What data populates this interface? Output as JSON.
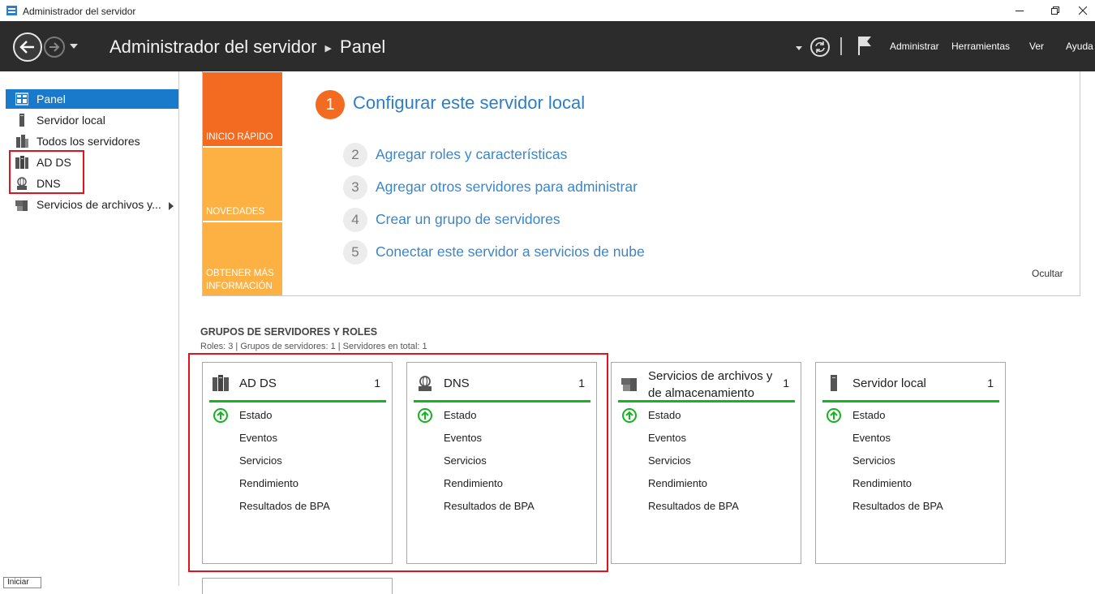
{
  "window": {
    "title": "Administrador del servidor",
    "controls": [
      "minimize",
      "restore",
      "close"
    ]
  },
  "header": {
    "breadcrumb_app": "Administrador del servidor",
    "breadcrumb_page": "Panel",
    "menu": {
      "administrar": "Administrar",
      "herramientas": "Herramientas",
      "ver": "Ver",
      "ayuda": "Ayuda"
    },
    "icons": [
      "back-icon",
      "forward-icon",
      "refresh-icon",
      "flag-icon"
    ]
  },
  "sidebar": {
    "items": [
      {
        "label": "Panel",
        "icon": "dashboard-icon",
        "active": true
      },
      {
        "label": "Servidor local",
        "icon": "server-icon"
      },
      {
        "label": "Todos los servidores",
        "icon": "servers-icon"
      },
      {
        "label": "AD DS",
        "icon": "adds-icon"
      },
      {
        "label": "DNS",
        "icon": "dns-icon"
      },
      {
        "label": "Servicios de archivos y...",
        "icon": "file-services-icon",
        "has_submenu": true
      }
    ]
  },
  "quick_start": {
    "tiles": {
      "inicio": "INICIO RÁPIDO",
      "novedades": "NOVEDADES",
      "obtener": "OBTENER MÁS INFORMACIÓN"
    },
    "step1": {
      "num": "1",
      "text": "Configurar este servidor local"
    },
    "steps": [
      {
        "num": "2",
        "text": "Agregar roles y características"
      },
      {
        "num": "3",
        "text": "Agregar otros servidores para administrar"
      },
      {
        "num": "4",
        "text": "Crear un grupo de servidores"
      },
      {
        "num": "5",
        "text": "Conectar este servidor a servicios de nube"
      }
    ],
    "hide": "Ocultar"
  },
  "groups": {
    "title": "GRUPOS DE SERVIDORES Y ROLES",
    "subtitle": "Roles: 3   |   Grupos de servidores: 1   |   Servidores en total: 1",
    "cards": [
      {
        "title": "AD DS",
        "count": "1",
        "icon": "adds-icon",
        "rows": [
          "Estado",
          "Eventos",
          "Servicios",
          "Rendimiento",
          "Resultados de BPA"
        ]
      },
      {
        "title": "DNS",
        "count": "1",
        "icon": "dns-icon",
        "rows": [
          "Estado",
          "Eventos",
          "Servicios",
          "Rendimiento",
          "Resultados de BPA"
        ]
      },
      {
        "title_line1": "Servicios de archivos y",
        "title_line2": "de almacenamiento",
        "count": "1",
        "icon": "file-services-icon",
        "rows": [
          "Estado",
          "Eventos",
          "Servicios",
          "Rendimiento",
          "Resultados de BPA"
        ]
      },
      {
        "title": "Servidor local",
        "count": "1",
        "icon": "server-icon",
        "rows": [
          "Estado",
          "Eventos",
          "Servicios",
          "Rendimiento",
          "Resultados de BPA"
        ]
      }
    ],
    "status_color": "#13b520"
  },
  "tooltip": "Iniciar",
  "colors": {
    "header_bg": "#2c2c2c",
    "active_item": "#1979ca",
    "orange": "#f26b20",
    "amber": "#fdb143",
    "link_blue": "#3a86c8",
    "highlight_red": "#e0141e"
  }
}
